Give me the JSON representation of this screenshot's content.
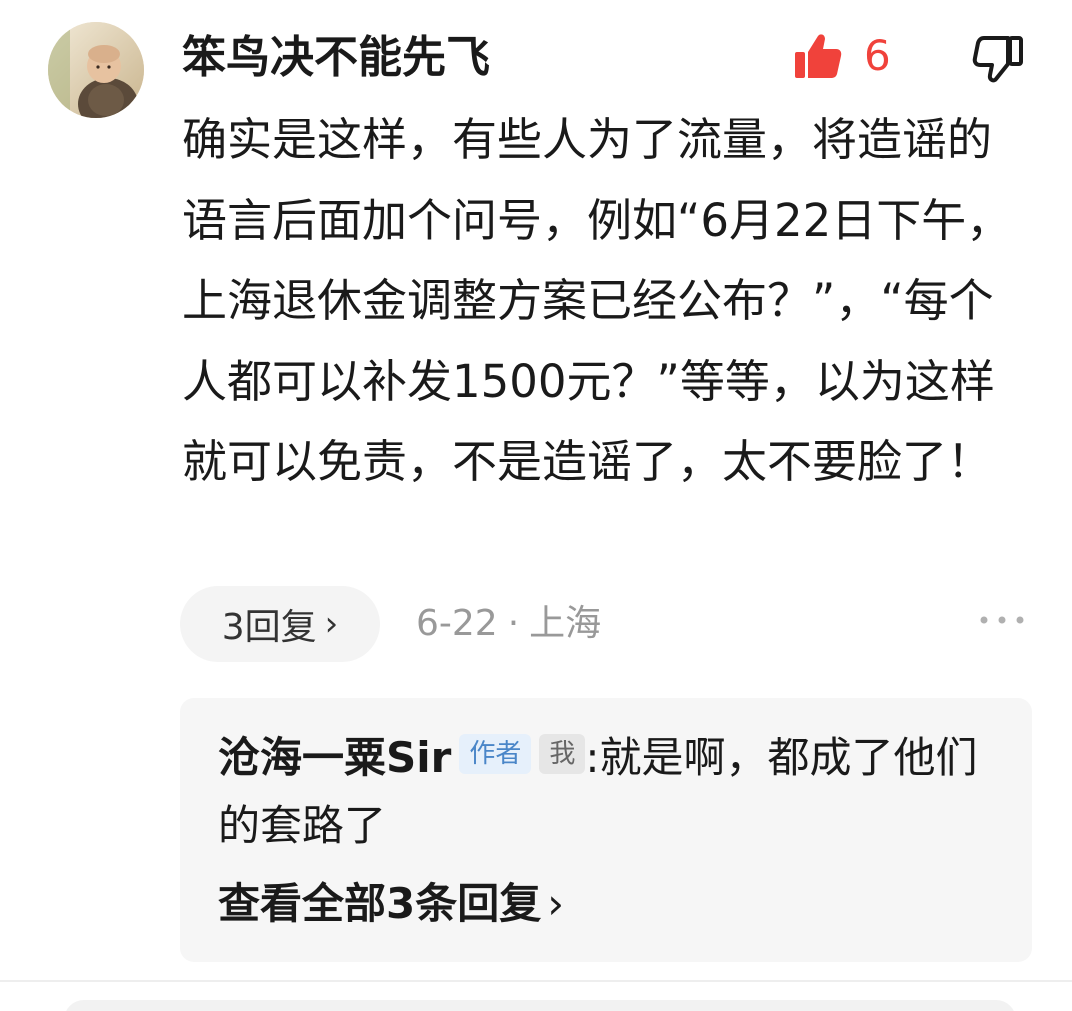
{
  "comment": {
    "username": "笨鸟决不能先飞",
    "like_count": "6",
    "text": "确实是这样，有些人为了流量，将造谣的语言后面加个问号，例如“6月22日下午，上海退休金调整方案已经公布？”，“每个人都可以补发1500元？”等等，以为这样就可以免责，不是造谣了，太不要脸了！",
    "replies_label": "3回复",
    "date": "6-22",
    "location": "上海"
  },
  "reply": {
    "author": "沧海一粟Sir",
    "author_badge": "作者",
    "me_badge": "我",
    "separator": ":",
    "text": "就是啊，都成了他们的套路了",
    "view_all_label": "查看全部3条回复"
  },
  "icons": {
    "like": "thumbs-up-icon",
    "dislike": "thumbs-down-icon",
    "more": "more-dots-icon",
    "chevron": "chevron-right-icon"
  },
  "colors": {
    "like_accent": "#f0423b",
    "meta_gray": "#999999",
    "author_badge_text": "#4a86c8",
    "reply_background": "#f6f6f6"
  }
}
